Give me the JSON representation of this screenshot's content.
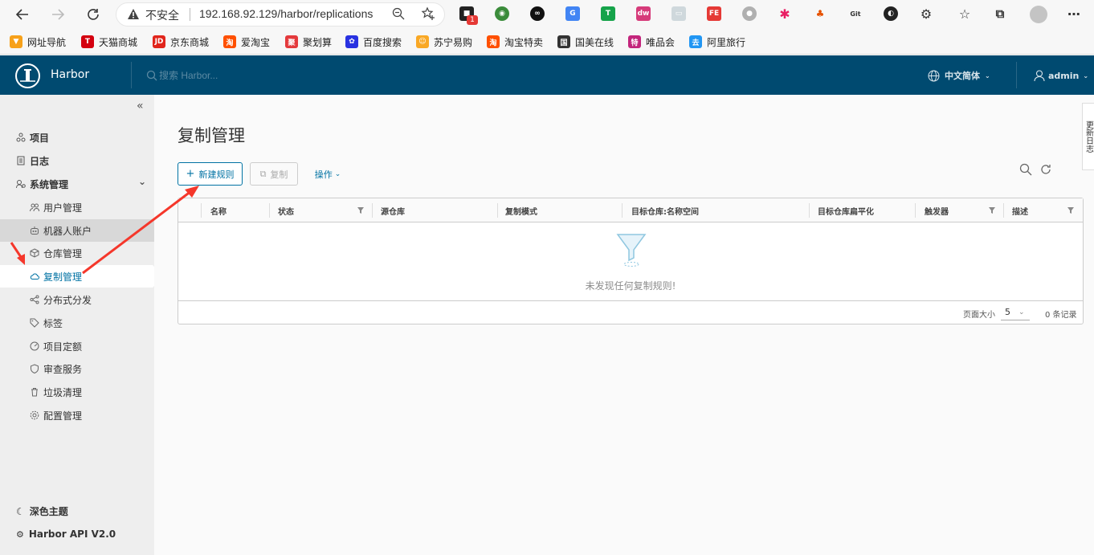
{
  "browser": {
    "insecure_label": "不安全",
    "url": "192.168.92.129/harbor/replications",
    "extension_badge": "1"
  },
  "bookmarks": [
    {
      "label": "网址导航",
      "color": "#f7a11a",
      "glyph": "▼"
    },
    {
      "label": "天猫商城",
      "color": "#d4000f",
      "glyph": "T"
    },
    {
      "label": "京东商城",
      "color": "#e1251b",
      "glyph": "JD"
    },
    {
      "label": "爱淘宝",
      "color": "#ff5000",
      "glyph": "淘"
    },
    {
      "label": "聚划算",
      "color": "#e4393c",
      "glyph": "聚"
    },
    {
      "label": "百度搜索",
      "color": "#2932e1",
      "glyph": "✿"
    },
    {
      "label": "苏宁易购",
      "color": "#f9a825",
      "glyph": "☺"
    },
    {
      "label": "淘宝特卖",
      "color": "#ff5000",
      "glyph": "淘"
    },
    {
      "label": "国美在线",
      "color": "#333333",
      "glyph": "国"
    },
    {
      "label": "唯品会",
      "color": "#c3257c",
      "glyph": "特"
    },
    {
      "label": "阿里旅行",
      "color": "#2196f3",
      "glyph": "去"
    }
  ],
  "header": {
    "brand": "Harbor",
    "search_placeholder": "搜索 Harbor...",
    "language": "中文简体",
    "user": "admin"
  },
  "sidebar": {
    "items": [
      {
        "label": "项目",
        "icon": "projects-icon",
        "level": "top"
      },
      {
        "label": "日志",
        "icon": "logs-icon",
        "level": "top"
      },
      {
        "label": "系统管理",
        "icon": "admin-icon",
        "level": "top"
      },
      {
        "label": "用户管理",
        "icon": "users-icon",
        "level": "sub"
      },
      {
        "label": "机器人账户",
        "icon": "robot-icon",
        "level": "sub"
      },
      {
        "label": "仓库管理",
        "icon": "registry-icon",
        "level": "sub"
      },
      {
        "label": "复制管理",
        "icon": "replication-icon",
        "level": "sub"
      },
      {
        "label": "分布式分发",
        "icon": "distribution-icon",
        "level": "sub"
      },
      {
        "label": "标签",
        "icon": "tag-icon",
        "level": "sub"
      },
      {
        "label": "项目定额",
        "icon": "quota-icon",
        "level": "sub"
      },
      {
        "label": "审查服务",
        "icon": "interrogation-icon",
        "level": "sub"
      },
      {
        "label": "垃圾清理",
        "icon": "trash-icon",
        "level": "sub"
      },
      {
        "label": "配置管理",
        "icon": "config-icon",
        "level": "sub"
      }
    ],
    "dark_theme": "深色主题",
    "api": "Harbor API V2.0"
  },
  "main": {
    "title": "复制管理",
    "new_rule": "新建规则",
    "copy": "复制",
    "actions": "操作",
    "columns": [
      "名称",
      "状态",
      "源仓库",
      "复制模式",
      "目标仓库:名称空间",
      "目标仓库扁平化",
      "触发器",
      "描述"
    ],
    "empty_text": "未发现任何复制规则!",
    "page_size_label": "页面大小",
    "page_size": "5",
    "record_count": "0 条记录"
  },
  "changelog": "更新日志",
  "colors": {
    "header": "#004a70",
    "accent": "#0072a3",
    "annotation": "#f5372b"
  }
}
